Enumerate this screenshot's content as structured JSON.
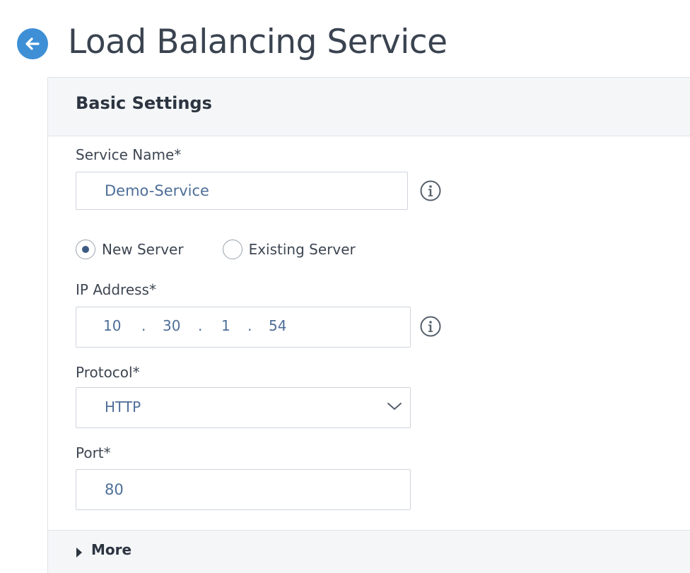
{
  "header": {
    "title": "Load Balancing Service",
    "back_icon": "arrow-left-icon",
    "accent_color": "#3e8fd6"
  },
  "basic_settings": {
    "title": "Basic Settings",
    "service_name": {
      "label": "Service Name*",
      "value": "Demo-Service",
      "info_icon": "info-icon"
    },
    "server_type": {
      "options": [
        {
          "label": "New Server",
          "selected": true
        },
        {
          "label": "Existing Server",
          "selected": false
        }
      ]
    },
    "ip_address": {
      "label": "IP Address*",
      "octets": [
        "10",
        "30",
        "1",
        "54"
      ],
      "separator": ".",
      "info_icon": "info-icon"
    },
    "protocol": {
      "label": "Protocol*",
      "value": "HTTP",
      "chevron_icon": "chevron-down-icon"
    },
    "port": {
      "label": "Port*",
      "value": "80"
    }
  },
  "more": {
    "label": "More",
    "expand_icon": "caret-right-icon"
  }
}
